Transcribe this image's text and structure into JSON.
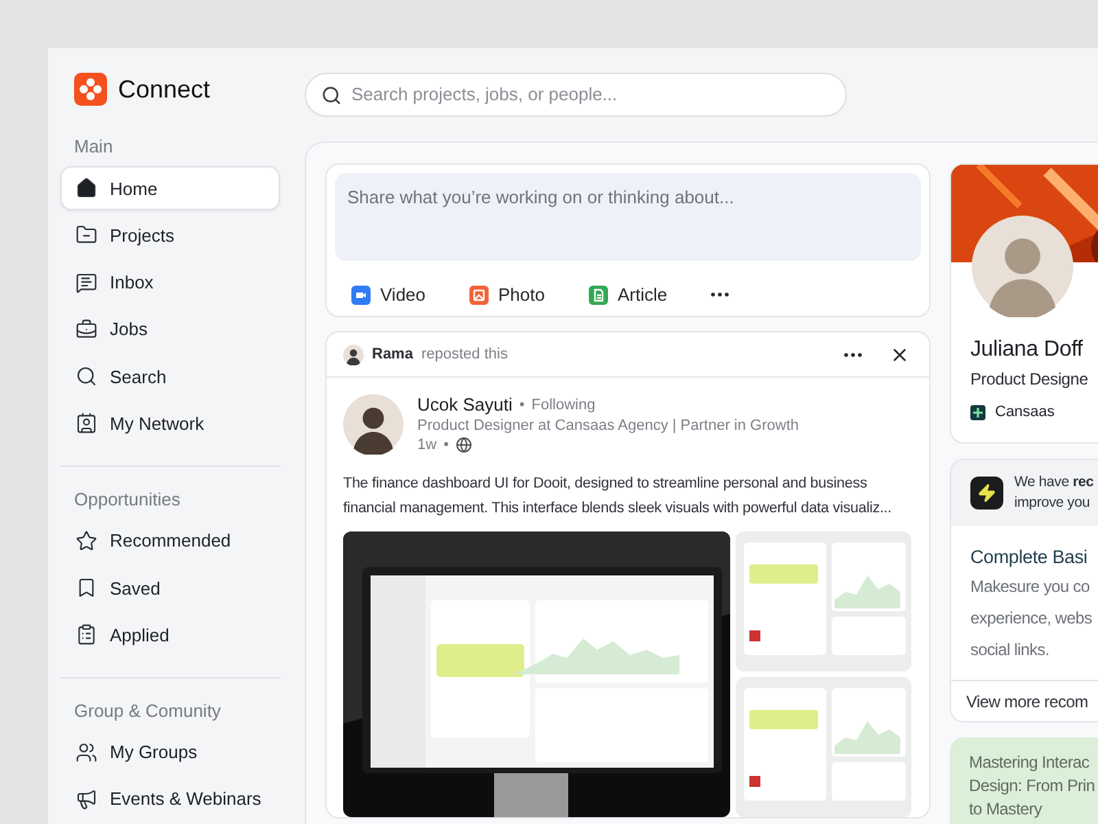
{
  "app": {
    "name": "Connect"
  },
  "search": {
    "placeholder": "Search projects, jobs, or people..."
  },
  "sidebar": {
    "sections": [
      {
        "title": "Main",
        "items": [
          {
            "label": "Home",
            "selected": true
          },
          {
            "label": "Projects",
            "selected": false
          },
          {
            "label": "Inbox",
            "selected": false
          },
          {
            "label": "Jobs",
            "selected": false
          },
          {
            "label": "Search",
            "selected": false
          },
          {
            "label": "My Network",
            "selected": false
          }
        ]
      },
      {
        "title": "Opportunities",
        "items": [
          {
            "label": "Recommended",
            "selected": false
          },
          {
            "label": "Saved",
            "selected": false
          },
          {
            "label": "Applied",
            "selected": false
          }
        ]
      },
      {
        "title": "Group & Comunity",
        "items": [
          {
            "label": "My Groups",
            "selected": false
          },
          {
            "label": "Events & Webinars",
            "selected": false
          }
        ]
      }
    ]
  },
  "composer": {
    "placeholder": "Share what you’re working on or thinking about...",
    "actions": [
      {
        "label": "Video",
        "kind": "video"
      },
      {
        "label": "Photo"
      },
      {
        "label": "Article",
        "kind": "article"
      }
    ]
  },
  "post": {
    "repost": {
      "name": "Rama",
      "action": "reposted this"
    },
    "author": {
      "name": "Ucok Sayuti",
      "follow_separator": "•",
      "relation": "Following",
      "headline": "Product Designer at Cansaas Agency | Partner in Growth",
      "time": "1w",
      "time_separator": "•"
    },
    "text": "The finance dashboard UI for Dooit, designed to streamline personal and business financial management. This  interface blends sleek visuals with powerful data visualiz..."
  },
  "profile": {
    "name": "Juliana Doff",
    "title": "Product Designe",
    "company": "Cansaas"
  },
  "recommendation": {
    "intro": [
      "We have **rec**",
      "improve you"
    ],
    "heading": "Complete Basi",
    "body": [
      "Makesure you co",
      "experience, webs",
      "social links."
    ],
    "footer": "View more recom"
  },
  "course": {
    "lines": [
      "Mastering Interac",
      "Design: From Prin",
      "to Mastery"
    ]
  }
}
